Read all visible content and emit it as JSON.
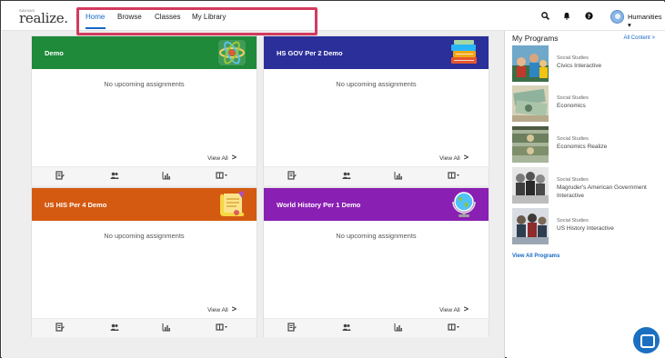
{
  "header": {
    "logo_small": "SAVVAS",
    "logo_main": "realize.",
    "nav": [
      {
        "label": "Home",
        "active": true
      },
      {
        "label": "Browse",
        "active": false
      },
      {
        "label": "Classes",
        "active": false
      },
      {
        "label": "My Library",
        "active": false
      }
    ],
    "icons": [
      "search-icon",
      "bell-icon",
      "help-icon"
    ],
    "user_label": "Humanities ▾"
  },
  "classes": [
    {
      "title": "Demo",
      "color": "#1f8a3a",
      "empty_text": "No upcoming assignments",
      "view_all": "View All",
      "art": "atom-icon"
    },
    {
      "title": "HS GOV Per 2 Demo",
      "color": "#2b2f9a",
      "empty_text": "No upcoming assignments",
      "view_all": "View All",
      "art": "books-icon"
    },
    {
      "title": "US HIS Per 4 Demo",
      "color": "#d45a12",
      "empty_text": "No upcoming assignments",
      "view_all": "View All",
      "art": "scroll-icon"
    },
    {
      "title": "World History Per 1 Demo",
      "color": "#8a1fb3",
      "empty_text": "No upcoming assignments",
      "view_all": "View All",
      "art": "globe-icon"
    }
  ],
  "card_footer_icons": [
    "assign-icon",
    "students-icon",
    "gradebook-icon",
    "more-options-icon"
  ],
  "programs": {
    "title": "My Programs",
    "all_content": "All Content >",
    "items": [
      {
        "subject": "Social Studies",
        "name": "Civics Interactive"
      },
      {
        "subject": "Social Studies",
        "name": "Economics"
      },
      {
        "subject": "Social Studies",
        "name": "Economics Realize"
      },
      {
        "subject": "Social Studies",
        "name": "Magruder's American Government Interactive"
      },
      {
        "subject": "Social Studies",
        "name": "US History Interactive"
      }
    ],
    "view_all": "View All Programs"
  },
  "colors": {
    "accent": "#1767c4",
    "highlight_box": "#d23b5e"
  }
}
